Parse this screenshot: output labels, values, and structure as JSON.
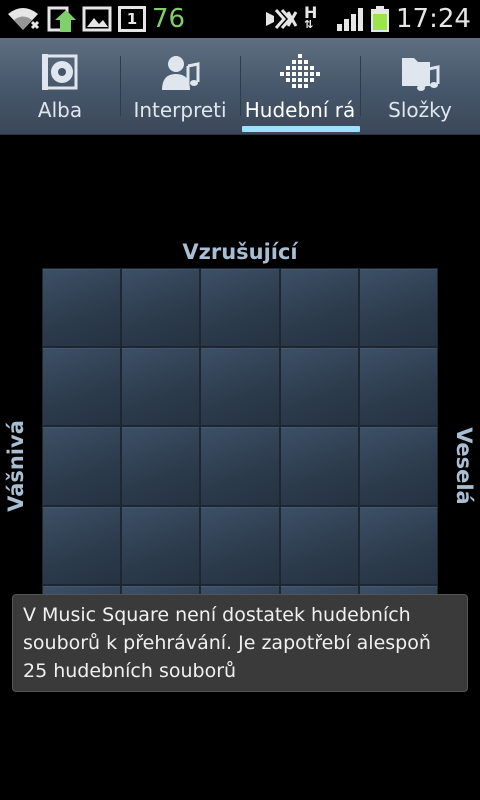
{
  "status_bar": {
    "icons": [
      "wifi-icon",
      "upload-icon",
      "gallery-icon",
      "calendar-icon",
      "mute-icon",
      "hspa-icon",
      "signal-icon",
      "battery-icon"
    ],
    "calendar_day": "1",
    "battery_level": "76",
    "network_type": "H",
    "clock": "17:24",
    "battery_color": "#9be54a"
  },
  "tabs": [
    {
      "label": "Alba",
      "icon": "album-icon"
    },
    {
      "label": "Interpreti",
      "icon": "artist-icon"
    },
    {
      "label": "Hudební rá",
      "icon": "music-square-icon",
      "active": true
    },
    {
      "label": "Složky",
      "icon": "folder-music-icon"
    }
  ],
  "mood_square": {
    "top_label": "Vzrušující",
    "left_label": "Vášnivá",
    "right_label": "Veselá",
    "rows": 5,
    "cols": 5
  },
  "toast": {
    "message": "V Music Square není dostatek hudebních souborů k přehrávání. Je zapotřebí alespoň 25 hudebních souborů"
  },
  "colors": {
    "active_tab_indicator": "#9fe0ff",
    "mood_label": "#a8bed2",
    "battery_text": "#7fd06a"
  }
}
